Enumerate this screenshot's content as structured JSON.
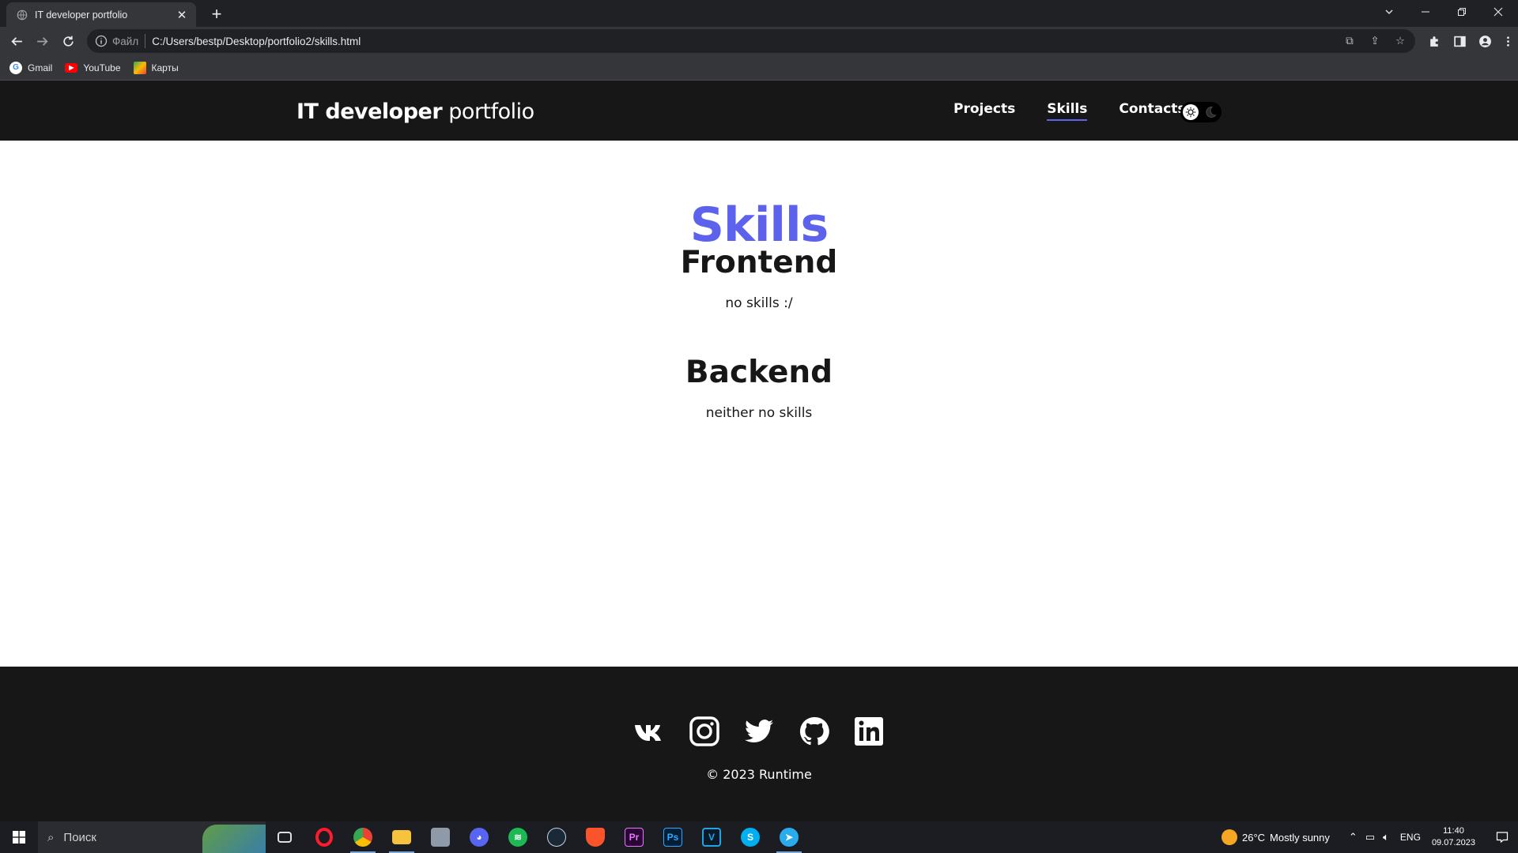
{
  "browser": {
    "tab_title": "IT developer portfolio",
    "address_prefix": "Файл",
    "address": "C:/Users/bestp/Desktop/portfolio2/skills.html",
    "bookmarks": [
      "Gmail",
      "YouTube",
      "Карты"
    ]
  },
  "site": {
    "logo_bold": "IT developer",
    "logo_light": "portfolio",
    "nav": [
      "Projects",
      "Skills",
      "Contacts"
    ],
    "active_nav": "Skills",
    "theme_icons": [
      "sun-icon",
      "moon-icon"
    ],
    "colors": {
      "accent": "#5c62ec",
      "dark": "#171718",
      "background": "#ffffff"
    }
  },
  "main": {
    "title": "Skills",
    "sections": [
      {
        "title": "Frontend",
        "text": "no skills :/"
      },
      {
        "title": "Backend",
        "text": "neither no skills"
      }
    ]
  },
  "footer": {
    "socials": [
      "vk-icon",
      "instagram-icon",
      "twitter-icon",
      "github-icon",
      "linkedin-icon"
    ],
    "copyright": "© 2023 Runtime"
  },
  "taskbar": {
    "search_placeholder": "Поиск",
    "apps": [
      "task-view-icon",
      "opera-icon",
      "chrome-icon",
      "file-explorer-icon",
      "app-icon",
      "discord-icon",
      "spotify-icon",
      "steam-icon",
      "brave-icon",
      "premiere-icon",
      "photoshop-icon",
      "vegas-icon",
      "skype-icon",
      "telegram-icon"
    ],
    "weather_temp": "26°C",
    "weather_text": "Mostly sunny",
    "language": "ENG",
    "time": "11:40",
    "date": "09.07.2023"
  }
}
